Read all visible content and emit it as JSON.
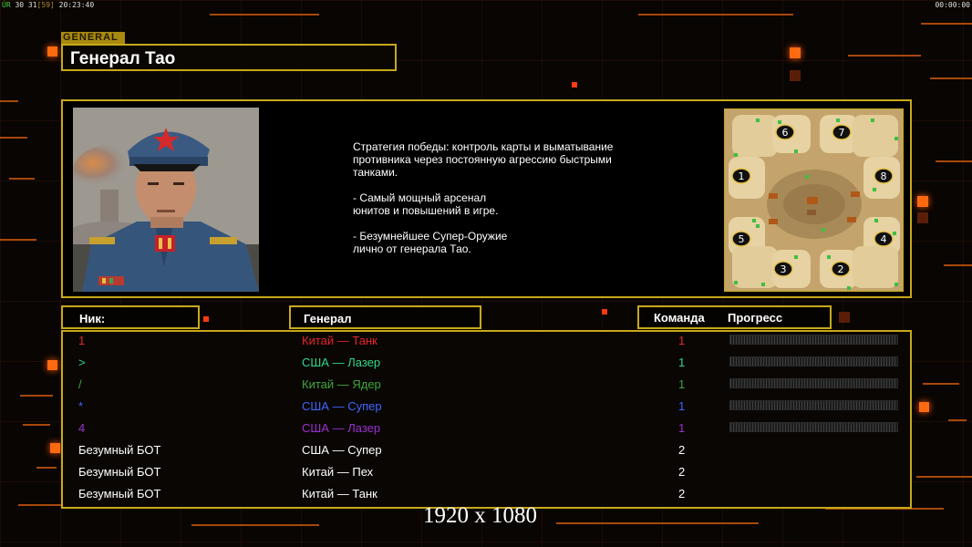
{
  "hud": {
    "fps_label": "ÚR",
    "fps_values": "30 31",
    "fps_bracket": "[59]",
    "clock_left": "20:23:40",
    "clock_right": "00:00:00"
  },
  "header": {
    "tag": "GENERAL",
    "title": "Генерал Тао"
  },
  "general": {
    "description": "Стратегия победы: контроль карты и выматывание\n противника через постоянную агрессию быстрыми\n танками.\n\n- Самый мощный арсенал\nюнитов и повышений в игре.\n\n- Безумнейшее Супер-Оружие\nлично от генерала Тао.",
    "map_slots": [
      "1",
      "2",
      "3",
      "4",
      "5",
      "6",
      "7",
      "8"
    ]
  },
  "columns": {
    "nick": "Ник:",
    "general": "Генерал",
    "team": "Команда",
    "progress": "Прогресс"
  },
  "players": [
    {
      "nick": "1",
      "general": "Китай — Танк",
      "team": "1",
      "color": "#e8242a",
      "progress": true
    },
    {
      "nick": ">",
      "general": "США — Лазер",
      "team": "1",
      "color": "#2fd98a",
      "progress": true
    },
    {
      "nick": "/",
      "general": "Китай — Ядер",
      "team": "1",
      "color": "#3ca83c",
      "progress": true
    },
    {
      "nick": "*",
      "general": "США — Супер",
      "team": "1",
      "color": "#3f66ff",
      "progress": true
    },
    {
      "nick": "4",
      "general": "США — Лазер",
      "team": "1",
      "color": "#9c2fd0",
      "progress": true
    },
    {
      "nick": "Безумный БОТ",
      "general": "США — Супер",
      "team": "2",
      "color": "#ffffff",
      "progress": false
    },
    {
      "nick": "Безумный БОТ",
      "general": "Китай — Пех",
      "team": "2",
      "color": "#ffffff",
      "progress": false
    },
    {
      "nick": "Безумный БОТ",
      "general": "Китай — Танк",
      "team": "2",
      "color": "#ffffff",
      "progress": false
    }
  ],
  "resolution": "1920 x 1080"
}
